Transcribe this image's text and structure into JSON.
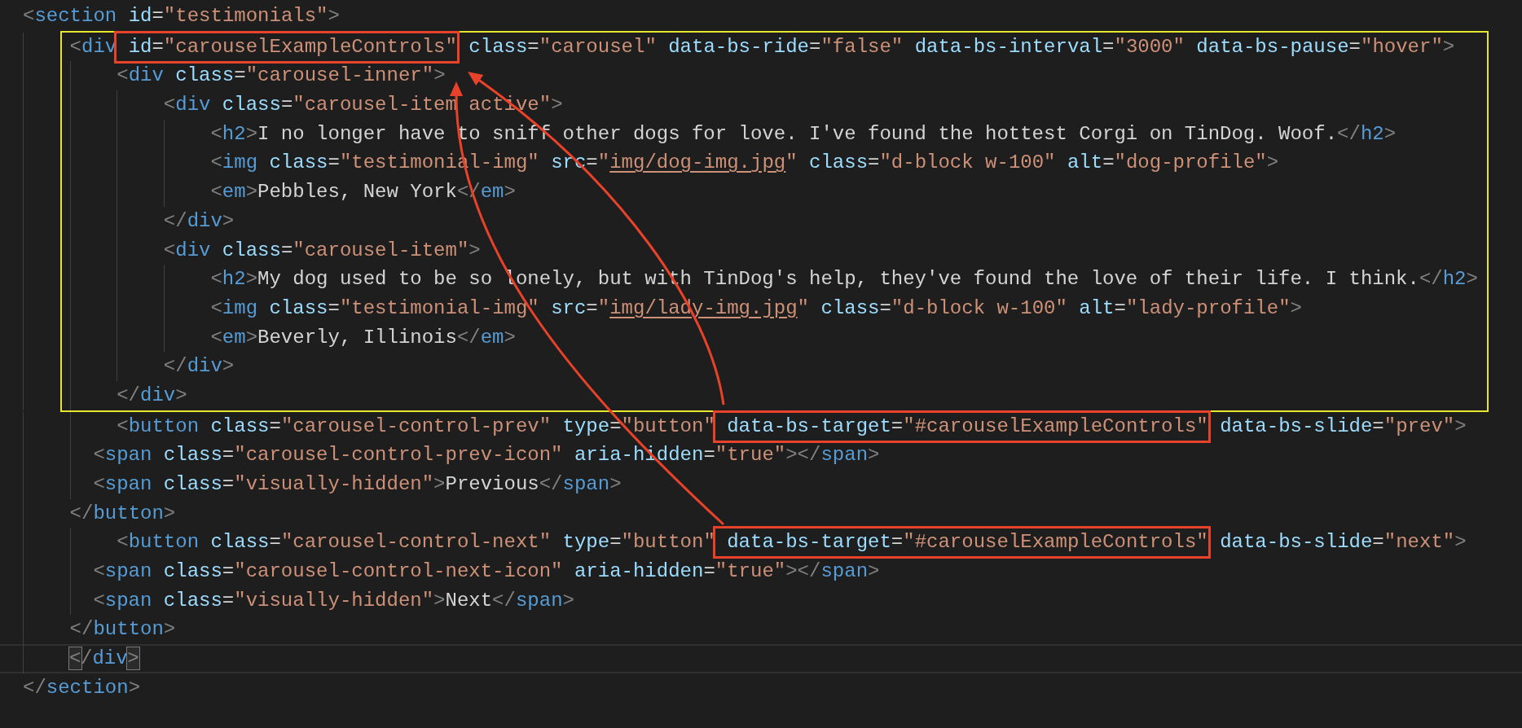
{
  "blocks": [
    {
      "framed": false,
      "lines": [
        {
          "current": false,
          "segments": [
            {
              "kind": "plain",
              "text": "<section id=\"testimonials\">"
            }
          ]
        }
      ]
    },
    {
      "framed": true,
      "lines": [
        {
          "current": false,
          "segments": [
            {
              "kind": "plain",
              "text": "\t<div"
            },
            {
              "kind": "annotation",
              "text": " id=\"carouselExampleControls\""
            },
            {
              "kind": "plain",
              "text": " class=\"carousel\" data-bs-ride=\"false\" data-bs-interval=\"3000\" data-bs-pause=\"hover\">"
            }
          ]
        },
        {
          "current": false,
          "segments": [
            {
              "kind": "plain",
              "text": "\t\t<div class=\"carousel-inner\">"
            }
          ]
        },
        {
          "current": false,
          "segments": [
            {
              "kind": "plain",
              "text": "\t\t\t<div class=\"carousel-item active\">"
            }
          ]
        },
        {
          "current": false,
          "segments": [
            {
              "kind": "plain",
              "text": "\t\t\t\t<h2>I no longer have to sniff other dogs for love. I've found the hottest Corgi on TinDog. Woof.</h2>"
            }
          ]
        },
        {
          "current": false,
          "segments": [
            {
              "kind": "plain",
              "text": "\t\t\t\t<img class=\"testimonial-img\" src=\""
            },
            {
              "kind": "link",
              "text": "img/dog-img.jpg"
            },
            {
              "kind": "plain",
              "text": "\" class=\"d-block w-100\" alt=\"dog-profile\">"
            }
          ]
        },
        {
          "current": false,
          "segments": [
            {
              "kind": "plain",
              "text": "\t\t\t\t<em>Pebbles, New York</em>"
            }
          ]
        },
        {
          "current": false,
          "segments": [
            {
              "kind": "plain",
              "text": "\t\t\t</div>"
            }
          ]
        },
        {
          "current": false,
          "segments": [
            {
              "kind": "plain",
              "text": "\t\t\t<div class=\"carousel-item\">"
            }
          ]
        },
        {
          "current": false,
          "segments": [
            {
              "kind": "plain",
              "text": "\t\t\t\t<h2>My dog used to be so lonely, but with TinDog's help, they've found the love of their life. I think.</h2>"
            }
          ]
        },
        {
          "current": false,
          "segments": [
            {
              "kind": "plain",
              "text": "\t\t\t\t<img class=\"testimonial-img\" src=\""
            },
            {
              "kind": "link",
              "text": "img/lady-img.jpg"
            },
            {
              "kind": "plain",
              "text": "\" class=\"d-block w-100\" alt=\"lady-profile\">"
            }
          ]
        },
        {
          "current": false,
          "segments": [
            {
              "kind": "plain",
              "text": "\t\t\t\t<em>Beverly, Illinois</em>"
            }
          ]
        },
        {
          "current": false,
          "segments": [
            {
              "kind": "plain",
              "text": "\t\t\t</div>"
            }
          ]
        },
        {
          "current": false,
          "segments": [
            {
              "kind": "plain",
              "text": "\t\t</div>"
            }
          ]
        }
      ]
    },
    {
      "framed": false,
      "lines": [
        {
          "current": false,
          "segments": [
            {
              "kind": "plain",
              "text": "\t\t<button class=\"carousel-control-prev\" type=\"button\""
            },
            {
              "kind": "annotation",
              "text": " data-bs-target=\"#carouselExampleControls\""
            },
            {
              "kind": "plain",
              "text": " data-bs-slide=\"prev\">"
            }
          ]
        },
        {
          "current": false,
          "segments": [
            {
              "kind": "plain",
              "text": "      <span class=\"carousel-control-prev-icon\" aria-hidden=\"true\"></span>"
            }
          ]
        },
        {
          "current": false,
          "segments": [
            {
              "kind": "plain",
              "text": "      <span class=\"visually-hidden\">Previous</span>"
            }
          ]
        },
        {
          "current": false,
          "segments": [
            {
              "kind": "plain",
              "text": "\t</button>"
            }
          ]
        },
        {
          "current": false,
          "segments": [
            {
              "kind": "plain",
              "text": "\t\t<button class=\"carousel-control-next\" type=\"button\""
            },
            {
              "kind": "annotation",
              "text": " data-bs-target=\"#carouselExampleControls\""
            },
            {
              "kind": "plain",
              "text": " data-bs-slide=\"next\">"
            }
          ]
        },
        {
          "current": false,
          "segments": [
            {
              "kind": "plain",
              "text": "      <span class=\"carousel-control-next-icon\" aria-hidden=\"true\"></span>"
            }
          ]
        },
        {
          "current": false,
          "segments": [
            {
              "kind": "plain",
              "text": "      <span class=\"visually-hidden\">Next</span>"
            }
          ]
        },
        {
          "current": false,
          "segments": [
            {
              "kind": "plain",
              "text": "\t</button>"
            }
          ]
        },
        {
          "current": true,
          "segments": [
            {
              "kind": "bracket",
              "text": "\t<"
            },
            {
              "kind": "plain",
              "text": "/div"
            },
            {
              "kind": "bracket",
              "text": ">"
            }
          ]
        },
        {
          "current": false,
          "segments": [
            {
              "kind": "plain",
              "text": "</section>"
            }
          ]
        }
      ]
    }
  ]
}
